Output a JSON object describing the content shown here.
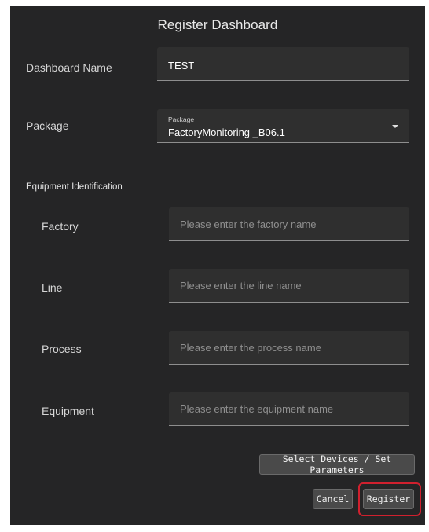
{
  "dialog": {
    "title": "Register Dashboard"
  },
  "dashboard_name": {
    "label": "Dashboard Name",
    "value": "TEST"
  },
  "package": {
    "label": "Package",
    "select_label": "Package",
    "selected_value": "FactoryMonitoring _B06.1"
  },
  "equipment_identification": {
    "section_label": "Equipment Identification",
    "factory": {
      "label": "Factory",
      "placeholder": "Please enter the factory name"
    },
    "line": {
      "label": "Line",
      "placeholder": "Please enter the line name"
    },
    "process": {
      "label": "Process",
      "placeholder": "Please enter the process name"
    },
    "equipment": {
      "label": "Equipment",
      "placeholder": "Please enter the equipment name"
    }
  },
  "actions": {
    "select_devices_label": "Select Devices / Set Parameters",
    "cancel_label": "Cancel",
    "register_label": "Register"
  },
  "colors": {
    "dialog_background": "#252526",
    "field_background": "#2f2f2f",
    "highlight": "#d0202e"
  }
}
